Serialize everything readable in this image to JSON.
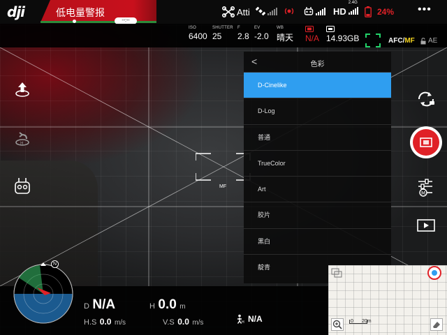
{
  "top_bar": {
    "logo": "dji",
    "warning": "低电量警报",
    "battery_time": "--:--",
    "flight_mode": "Atti",
    "hd_label": "HD",
    "band": "2.4G",
    "battery_percent": "24%",
    "more_label": "•••"
  },
  "camera_params": {
    "iso_label": "ISO",
    "iso": "6400",
    "shutter_label": "SHUTTER",
    "shutter": "25",
    "f_label": "F",
    "f": "2.8",
    "ev_label": "EV",
    "ev": "-2.0",
    "wb_label": "WB",
    "wb": "晴天",
    "format": "N/A",
    "storage": "14.93GB",
    "focus_mode_afc": "AFC",
    "focus_mode_sep": "/",
    "focus_mode_mf": "MF",
    "ae_lock": "AE"
  },
  "focus_box_label": "MF",
  "color_menu": {
    "back": "<",
    "title": "色彩",
    "selected_index": 0,
    "items": [
      "D-Cinelike",
      "D-Log",
      "普通",
      "TrueColor",
      "Art",
      "胶片",
      "黑白",
      "靛青"
    ]
  },
  "telemetry": {
    "d_label": "D",
    "d_value": "N/A",
    "h_label": "H",
    "h_value": "0.0",
    "h_unit": "m",
    "hs_label": "H.S",
    "hs_value": "0.0",
    "hs_unit": "m/s",
    "vs_label": "V.S",
    "vs_value": "0.0",
    "vs_unit": "m/s",
    "home_value": "N/A"
  },
  "radar": {
    "north_label": "N"
  },
  "mini_map": {
    "scale_zero": "0",
    "scale_label": "20m"
  },
  "colors": {
    "warning_red": "#c8101c",
    "accent_blue": "#2f9ef0",
    "battery_red": "#e02127",
    "focus_green": "#22d36a",
    "mf_yellow": "#f3d320"
  }
}
